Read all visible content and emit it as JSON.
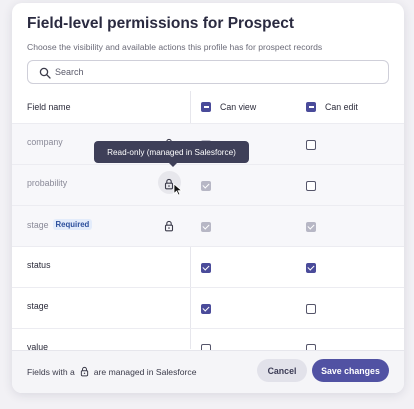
{
  "dialog": {
    "title": "Field-level permissions for Prospect",
    "subtitle": "Choose the visibility and available actions this profile has for prospect records"
  },
  "search": {
    "placeholder": "Search",
    "value": ""
  },
  "table": {
    "headers": {
      "field_name": "Field name",
      "can_view": "Can view",
      "can_edit": "Can edit"
    },
    "rows": [
      {
        "name": "company",
        "badge": "",
        "locked": true,
        "can_view": true,
        "can_edit": false
      },
      {
        "name": "probability",
        "badge": "",
        "locked": true,
        "can_view": true,
        "can_edit": false
      },
      {
        "name": "stage",
        "badge": "Required",
        "locked": true,
        "can_view": true,
        "can_edit": true
      },
      {
        "name": "status",
        "badge": "",
        "locked": false,
        "can_view": true,
        "can_edit": true
      },
      {
        "name": "stage",
        "badge": "",
        "locked": false,
        "can_view": true,
        "can_edit": false
      },
      {
        "name": "value",
        "badge": "",
        "locked": false,
        "can_view": false,
        "can_edit": false
      }
    ]
  },
  "tooltip": {
    "text": "Read-only (managed in Salesforce)"
  },
  "footer": {
    "note_prefix": "Fields with a",
    "note_suffix": "are managed in Salesforce",
    "cancel_label": "Cancel",
    "save_label": "Save changes"
  },
  "colors": {
    "accent": "#4a4b9a",
    "disabled_check": "#b7b7c5",
    "tooltip_bg": "#3e3f58"
  },
  "icons": {
    "search": "search-icon",
    "lock": "lock-icon",
    "cursor": "mouse-pointer-icon"
  }
}
